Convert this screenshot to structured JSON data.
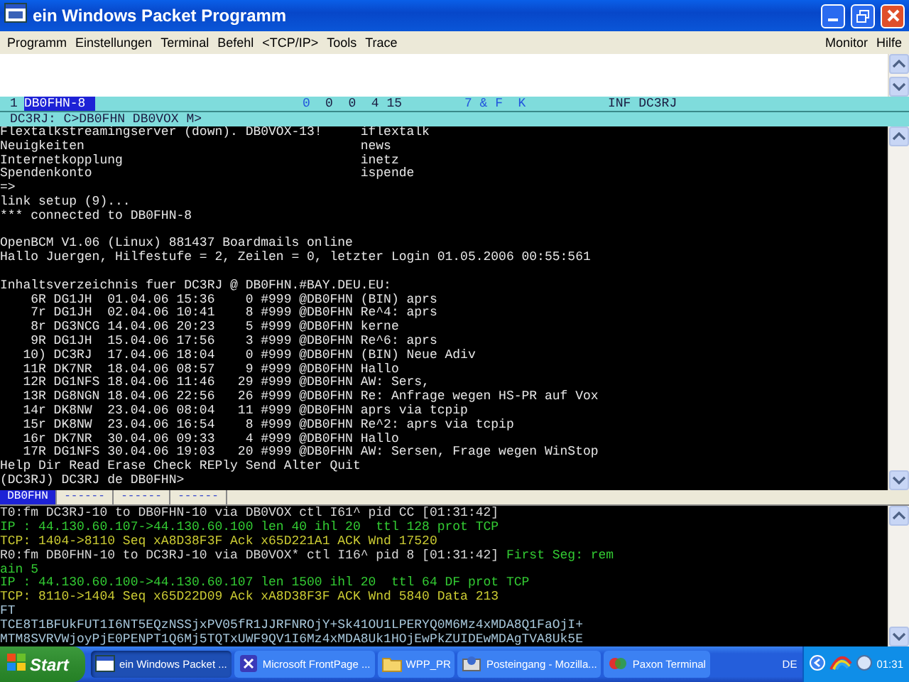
{
  "window": {
    "title": "ein Windows Packet Programm"
  },
  "menu": {
    "left": [
      "Programm",
      "Einstellungen",
      "Terminal",
      "Befehl",
      "<TCP/IP>",
      "Tools",
      "Trace"
    ],
    "right": [
      "Monitor",
      "Hilfe"
    ]
  },
  "status_bar": {
    "fields": [
      {
        "text": "1",
        "kind": "plain",
        "highlighted": false
      },
      {
        "text": "DB0FHN-8",
        "kind": "plain",
        "highlighted": true
      },
      {
        "text": "0",
        "kind": "flag",
        "highlighted": false
      },
      {
        "text": "0  0  4 15",
        "kind": "plain",
        "highlighted": false
      },
      {
        "text": "7 & F  K",
        "kind": "flag",
        "highlighted": false
      },
      {
        "text": "INF DC3RJ",
        "kind": "plain",
        "highlighted": false
      }
    ]
  },
  "connect_line": "DC3RJ: C>DB0FHN DB0VOX M>",
  "terminal": {
    "lines": [
      {
        "kind": "text",
        "text": "Flextalkstreamingserver (down). DB0VOX-13!     iflextalk"
      },
      {
        "kind": "text",
        "text": "Neuigkeiten                                    news"
      },
      {
        "kind": "text",
        "text": "Internetkopplung                               inetz"
      },
      {
        "kind": "text",
        "text": "Spendenkonto                                   ispende"
      },
      {
        "kind": "text",
        "text": "=>"
      },
      {
        "kind": "text",
        "text": "link setup (9)..."
      },
      {
        "kind": "text",
        "text": "*** connected to DB0FHN-8"
      },
      {
        "kind": "blank"
      },
      {
        "kind": "text",
        "text": "OpenBCM V1.06 (Linux) 881437 Boardmails online"
      },
      {
        "kind": "text",
        "text": "Hallo Juergen, Hilfestufe = 2, Zeilen = 0, letzter Login 01.05.2006 00:55:561"
      },
      {
        "kind": "blank"
      },
      {
        "kind": "text",
        "text": "Inhaltsverzeichnis fuer DC3RJ @ DB0FHN.#BAY.DEU.EU:"
      },
      {
        "kind": "text",
        "text": "    6R DG1JH  01.04.06 15:36    0 #999 @DB0FHN (BIN) aprs"
      },
      {
        "kind": "text",
        "text": "    7r DG1JH  02.04.06 10:41    8 #999 @DB0FHN Re^4: aprs"
      },
      {
        "kind": "text",
        "text": "    8r DG3NCG 14.04.06 20:23    5 #999 @DB0FHN kerne"
      },
      {
        "kind": "text",
        "text": "    9R DG1JH  15.04.06 17:56    3 #999 @DB0FHN Re^6: aprs"
      },
      {
        "kind": "text",
        "text": "   10) DC3RJ  17.04.06 18:04    0 #999 @DB0FHN (BIN) Neue Adiv"
      },
      {
        "kind": "text",
        "text": "   11R DK7NR  18.04.06 08:57    9 #999 @DB0FHN Hallo"
      },
      {
        "kind": "text",
        "text": "   12R DG1NFS 18.04.06 11:46   29 #999 @DB0FHN AW: Sers,"
      },
      {
        "kind": "text",
        "text": "   13R DG8NGN 18.04.06 22:56   26 #999 @DB0FHN Re: Anfrage wegen HS-PR auf Vox"
      },
      {
        "kind": "text",
        "text": "   14r DK8NW  23.04.06 08:04   11 #999 @DB0FHN aprs via tcpip"
      },
      {
        "kind": "text",
        "text": "   15r DK8NW  23.04.06 16:54    8 #999 @DB0FHN Re^2: aprs via tcpip"
      },
      {
        "kind": "text",
        "text": "   16r DK7NR  30.04.06 09:33    4 #999 @DB0FHN Hallo"
      },
      {
        "kind": "text",
        "text": "   17R DG1NFS 30.04.06 19:03   20 #999 @DB0FHN AW: Sersen, Frage wegen WinStop"
      },
      {
        "kind": "text",
        "text": "Help Dir Read Erase Check REPly Send Alter Quit"
      },
      {
        "kind": "text",
        "text": "(DC3RJ) DC3RJ de DB0FHN>"
      }
    ]
  },
  "channel_tabs": [
    {
      "label": "DB0FHN",
      "selected": true
    },
    {
      "label": "------",
      "selected": false
    },
    {
      "label": "------",
      "selected": false
    },
    {
      "label": "------",
      "selected": false
    }
  ],
  "monitor": {
    "lines": [
      {
        "segments": [
          {
            "text": "T0:fm DC3RJ-10 to DB0FHN-10 via DB0VOX ctl I61^ pid CC [01:31:42]",
            "color": "#d8d8d8"
          }
        ]
      },
      {
        "segments": [
          {
            "text": "IP : 44.130.60.107->44.130.60.100 len 40 ihl 20  ttl 128 prot TCP",
            "color": "#33cc33"
          }
        ]
      },
      {
        "segments": [
          {
            "text": "TCP: 1404->8110 Seq xA8D38F3F Ack x65D221A1 ACK Wnd 17520",
            "color": "#cccc33"
          }
        ]
      },
      {
        "segments": [
          {
            "text": "R0:fm DB0FHN-10 to DC3RJ-10 via DB0VOX* ctl I16^ pid 8 [01:31:42] ",
            "color": "#d8d8d8"
          },
          {
            "text": "First Seg: rem",
            "color": "#33cc33"
          }
        ]
      },
      {
        "segments": [
          {
            "text": "ain 5",
            "color": "#33cc33"
          }
        ]
      },
      {
        "segments": [
          {
            "text": "IP : 44.130.60.100->44.130.60.107 len 1500 ihl 20  ttl 64 DF prot TCP",
            "color": "#33cc33"
          }
        ]
      },
      {
        "segments": [
          {
            "text": "TCP: 8110->1404 Seq x65D22D09 Ack xA8D38F3F ACK Wnd 5840 Data 213",
            "color": "#cccc33"
          }
        ]
      },
      {
        "segments": [
          {
            "text": "FT",
            "color": "#a8c8dc"
          }
        ]
      },
      {
        "segments": [
          {
            "text": "TCE8T1BFUkFUT1I6NT5EQzNSSjxPV05fR1JJRFNROjY+Sk41OU1LPERYQ0M6Mz4xMDA8Q1FaOjI+",
            "color": "#a8c8dc"
          }
        ]
      },
      {
        "segments": [
          {
            "text": "MTM8SVRVWjoyPjE0PENPT1Q6Mj5TQTxUWF9QV1I6Mz4xMDA8Uk1HOjEwPkZUIDEwMDAgTVA8Uk5E",
            "color": "#a8c8dc"
          }
        ]
      }
    ]
  },
  "taskbar": {
    "start": "Start",
    "tasks": [
      {
        "label": "ein Windows Packet ...",
        "selected": true,
        "kind": "app"
      },
      {
        "label": "Microsoft FrontPage ...",
        "selected": false,
        "kind": "frontpage"
      },
      {
        "label": "WPP_PR",
        "selected": false,
        "kind": "folder"
      },
      {
        "label": "Posteingang - Mozilla...",
        "selected": false,
        "kind": "mail"
      },
      {
        "label": "Paxon Terminal",
        "selected": false,
        "kind": "paxon"
      }
    ],
    "language": "DE",
    "clock": "01:31"
  }
}
